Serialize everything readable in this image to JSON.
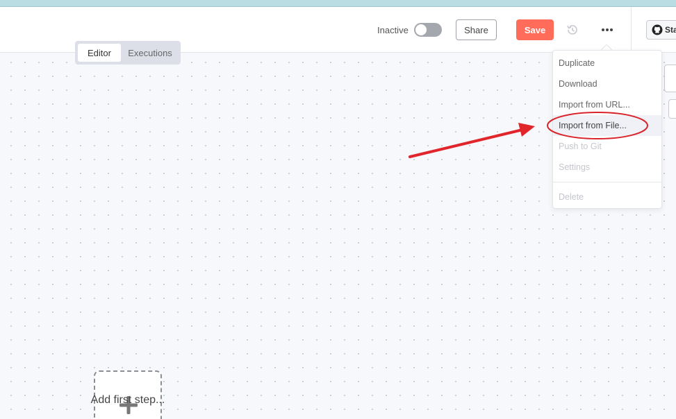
{
  "header": {
    "status_label": "Inactive",
    "share_label": "Share",
    "save_label": "Save",
    "star_label": "Star"
  },
  "tabs": [
    {
      "label": "Editor",
      "active": true
    },
    {
      "label": "Executions",
      "active": false
    }
  ],
  "menu": {
    "items": [
      {
        "label": "Duplicate",
        "state": "enabled"
      },
      {
        "label": "Download",
        "state": "enabled"
      },
      {
        "label": "Import from URL...",
        "state": "enabled"
      },
      {
        "label": "Import from File...",
        "state": "hovered"
      },
      {
        "label": "Push to Git",
        "state": "disabled"
      },
      {
        "label": "Settings",
        "state": "disabled"
      },
      {
        "label": "Delete",
        "state": "disabled"
      }
    ]
  },
  "canvas": {
    "add_step_label": "Add first step..."
  },
  "icons": {
    "history": "history-icon",
    "more": "more-horizontal-icon",
    "github": "github-icon",
    "plus": "plus-icon"
  },
  "colors": {
    "save_button": "#ff6d5a",
    "annotation": "#e0262b",
    "top_strip": "#b9dde2",
    "toggle_off": "#a4a7ae"
  }
}
